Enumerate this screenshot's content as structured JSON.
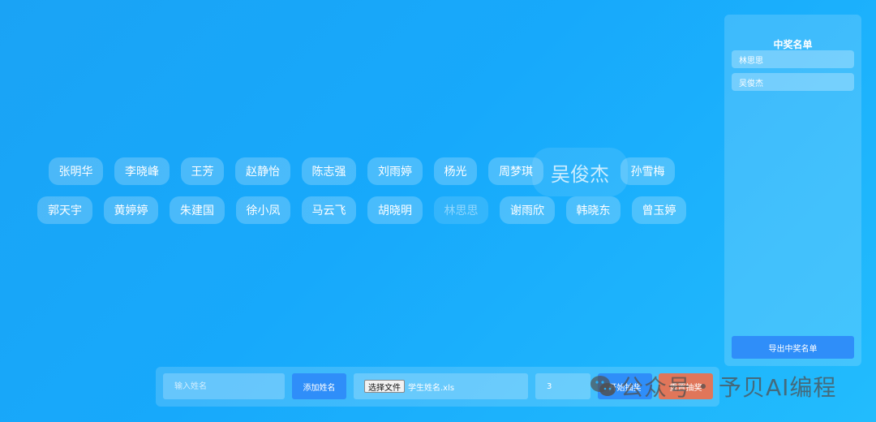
{
  "names_row1": [
    "张明华",
    "李晓峰",
    "王芳",
    "赵静怡",
    "陈志强",
    "刘雨婷",
    "杨光",
    "周梦琪",
    "孙雪梅"
  ],
  "highlight_name": "吴俊杰",
  "names_row2": [
    "郭天宇",
    "黄婷婷",
    "朱建国",
    "徐小凤",
    "马云飞",
    "胡晓明",
    "林思思",
    "谢雨欣",
    "韩晓东",
    "曾玉婷"
  ],
  "winners_panel": {
    "title": "中奖名单",
    "winners": [
      "林思思",
      "吴俊杰"
    ],
    "export_label": "导出中奖名单"
  },
  "controls": {
    "name_placeholder": "输入姓名",
    "add_label": "添加姓名",
    "file_button_label": "选择文件",
    "file_name": "学生姓名.xls",
    "count_value": "3",
    "start_label": "开始抽奖",
    "reset_label": "重置抽奖"
  },
  "watermark": {
    "account_type": "公众号",
    "account_name": "予贝AI编程"
  }
}
